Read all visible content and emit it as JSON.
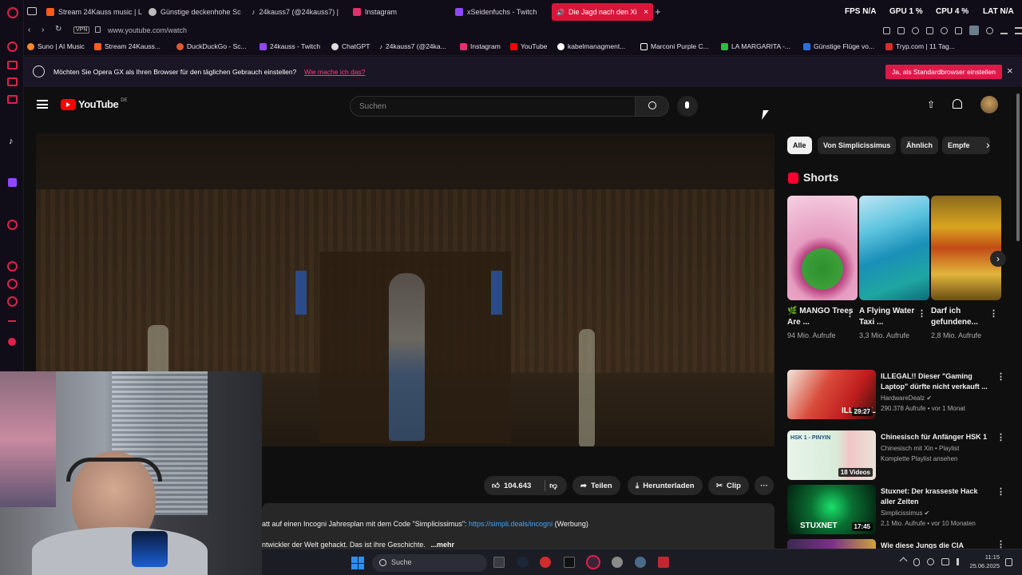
{
  "browser": {
    "tabs": [
      {
        "label": "Stream 24Kauss music | L",
        "color": "#ff5a1f"
      },
      {
        "label": "Günstige deckenhohe Sc",
        "color": "#bbbbbb"
      },
      {
        "label": "24kauss7 (@24kauss7) |",
        "color": "#ffffff"
      },
      {
        "label": "Instagram",
        "color": "#e1306c"
      },
      {
        "label": "xSeidenfuchs - Twitch",
        "color": "#9146ff"
      },
      {
        "label": "Die Jagd nach den Xi",
        "color": "#ffffff"
      }
    ],
    "new_tab": "+",
    "stats": {
      "fps_label": "FPS",
      "fps_value": "N/A",
      "gpu_label": "GPU",
      "gpu_value": "1 %",
      "cpu_label": "CPU",
      "cpu_value": "4 %",
      "lat_label": "LAT",
      "lat_value": "N/A"
    },
    "vpn": "VPN",
    "url": "www.youtube.com/watch",
    "bookmarks": [
      {
        "label": "Suno | AI Music",
        "color": "#f58a2a"
      },
      {
        "label": "Stream 24Kauss...",
        "color": "#ff5a1f"
      },
      {
        "label": "DuckDuckGo - Sc...",
        "color": "#de5833"
      },
      {
        "label": "24kauss - Twitch",
        "color": "#9146ff"
      },
      {
        "label": "ChatGPT",
        "color": "#dddddd"
      },
      {
        "label": "24kauss7 (@24ka...",
        "color": "#ffffff"
      },
      {
        "label": "Instagram",
        "color": "#e1306c"
      },
      {
        "label": "YouTube",
        "color": "#ff0000"
      },
      {
        "label": "kabelmanagment...",
        "color": "#ffffff"
      },
      {
        "label": "Marconi Purple C...",
        "color": "#ffffff"
      },
      {
        "label": "LA MARGARITA -...",
        "color": "#2bbd40"
      },
      {
        "label": "Günstige Flüge vo...",
        "color": "#2f6fdb"
      },
      {
        "label": "Tryp.com | 11 Tag...",
        "color": "#e02a2a"
      }
    ]
  },
  "notification": {
    "text": "Möchten Sie Opera GX als Ihren Browser für den täglichen Gebrauch einstellen?",
    "link": "Wie mache ich das?",
    "button": "Ja, als Standardbrowser einstellen",
    "close": "×"
  },
  "youtube": {
    "logo": "YouTube",
    "region": "DE",
    "search_placeholder": "Suchen",
    "chips": [
      "Alle",
      "Von Simplicissimus",
      "Ähnlich",
      "Empfe"
    ],
    "shorts_heading": "Shorts",
    "shorts": [
      {
        "title": "🌿 MANGO Trees Are ...",
        "views": "94 Mio. Aufrufe"
      },
      {
        "title": "A Flying Water Taxi ...",
        "views": "3,3 Mio. Aufrufe"
      },
      {
        "title": "Darf ich gefundene...",
        "views": "2,8 Mio. Aufrufe"
      }
    ],
    "recommendations": [
      {
        "title": "ILLEGAL!! Dieser \"Gaming Laptop\" dürfte nicht verkauft ...",
        "channel": "HardwareDealz ✔",
        "meta": "290.378 Aufrufe • vor 1 Monat",
        "duration": "29:27"
      },
      {
        "title": "Chinesisch für Anfänger HSK 1",
        "channel": "Chinesisch mit Xin • Playlist",
        "meta": "Komplette Playlist ansehen",
        "duration": "18 Videos"
      },
      {
        "title": "Stuxnet: Der krasseste Hack aller Zeiten",
        "channel": "Simplicissimus ✔",
        "meta": "2,1 Mio. Aufrufe • vor 10 Monaten",
        "duration": "17:45"
      },
      {
        "title": "Wie diese Jungs die CIA",
        "channel": "",
        "meta": "",
        "duration": ""
      }
    ],
    "actions": {
      "likes": "104.643",
      "share": "Teilen",
      "download": "Herunterladen",
      "clip": "Clip"
    },
    "description": {
      "line1_prefix": "att auf einen Incogni Jahresplan mit dem Code \"Simplicissimus\": ",
      "line1_link": "https://simpli.deals/incogni",
      "line1_suffix": " (Werbung)",
      "line2": "ntwickler der Welt gehackt. Das ist ihre Geschichte.",
      "more": "...mehr"
    },
    "thumbnail_texts": {
      "stuxnet": "STUXNET",
      "illegal": "ILLEGAL",
      "hsk": "HSK 1 - PINYIN"
    }
  },
  "taskbar": {
    "search": "Suche",
    "time": "11:15",
    "date": "25.06.2025"
  }
}
